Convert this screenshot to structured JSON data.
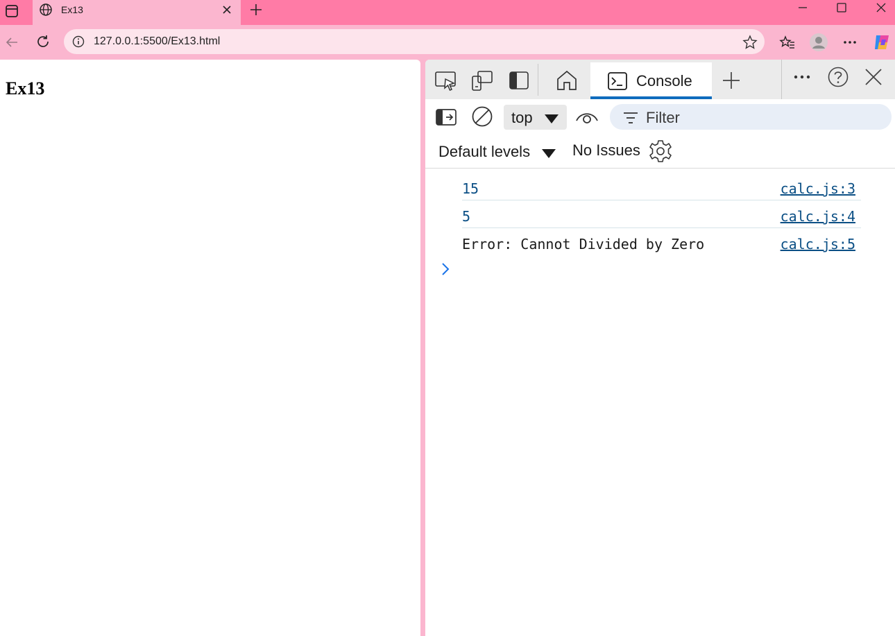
{
  "browser": {
    "tab_title": "Ex13",
    "url": "127.0.0.1:5500/Ex13.html"
  },
  "page": {
    "heading": "Ex13"
  },
  "devtools": {
    "active_tab": "Console",
    "context": "top",
    "filter_placeholder": "Filter",
    "levels": "Default levels",
    "issues": "No Issues",
    "logs": [
      {
        "message": "15",
        "source": "calc.js:3"
      },
      {
        "message": "5",
        "source": "calc.js:4"
      },
      {
        "message": "Error: Cannot Divided by Zero",
        "source": "calc.js:5"
      }
    ]
  },
  "colors": {
    "titlebar": "#ff7ba6",
    "toolbar": "#fbb6cf",
    "accent": "#0f6cbd"
  }
}
